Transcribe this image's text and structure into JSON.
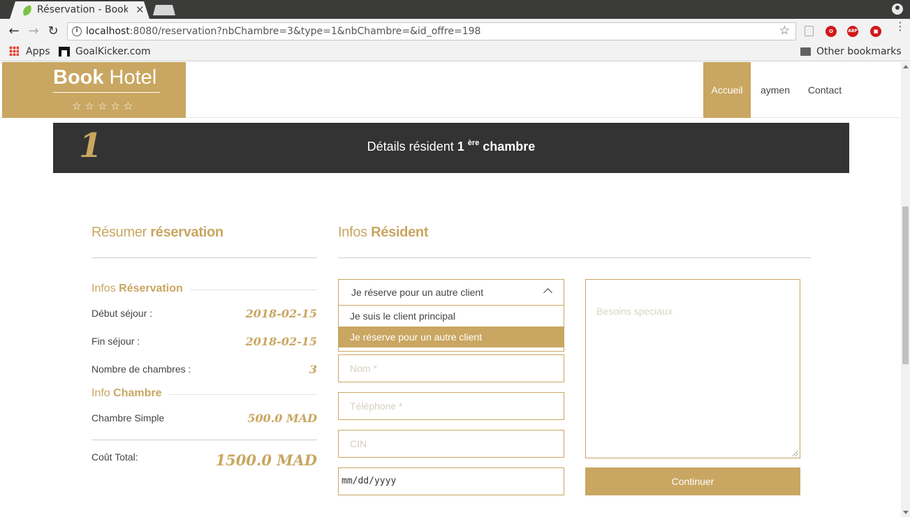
{
  "browser": {
    "tab_title": "Réservation - Book",
    "tab_close": "✕",
    "url_host": "localhost",
    "url_rest": ":8080/reservation?nbChambre=3&type=1&nbChambre=&id_offre=198",
    "bookmarks": {
      "apps": "Apps",
      "goalkicker": "GoalKicker.com",
      "other": "Other bookmarks"
    },
    "extensions": {
      "abp": "ABP"
    }
  },
  "header": {
    "logo_bold": "Book",
    "logo_light": " Hotel",
    "stars": "☆☆☆☆☆",
    "nav": [
      "Accueil",
      "aymen",
      "Contact"
    ]
  },
  "step": {
    "number": "1",
    "title_prefix": "Détails résident ",
    "title_num": "1",
    "title_sup": "ère",
    "title_suffix": " chambre"
  },
  "summary": {
    "title_light": "Résumer ",
    "title_bold": "réservation",
    "infos_reservation_light": "Infos ",
    "infos_reservation_bold": "Réservation",
    "rows": [
      {
        "label": "Début séjour :",
        "value": "2018-02-15"
      },
      {
        "label": "Fin séjour :",
        "value": "2018-02-15"
      },
      {
        "label": "Nombre de chambres :",
        "value": "3"
      }
    ],
    "info_chambre_light": "Info ",
    "info_chambre_bold": "Chambre",
    "room": {
      "label": "Chambre Simple",
      "value": "500.0 MAD"
    },
    "total": {
      "label": "Coût Total:",
      "value": "1500.0 MAD"
    }
  },
  "resident": {
    "title_light": "Infos ",
    "title_bold": "Résident",
    "select_value": "Je réserve pour un autre client",
    "options": [
      "Je suis le client principal",
      "Je réserve pour un autre client"
    ],
    "nom_placeholder": "Nom *",
    "telephone_placeholder": "Téléphone *",
    "cin_placeholder": "CIN",
    "date_placeholder": "mm/dd/yyyy",
    "besoins_placeholder": "Besoins speciaux",
    "continue_label": "Continuer"
  },
  "colors": {
    "accent": "#c9a661",
    "banner": "#333333"
  }
}
